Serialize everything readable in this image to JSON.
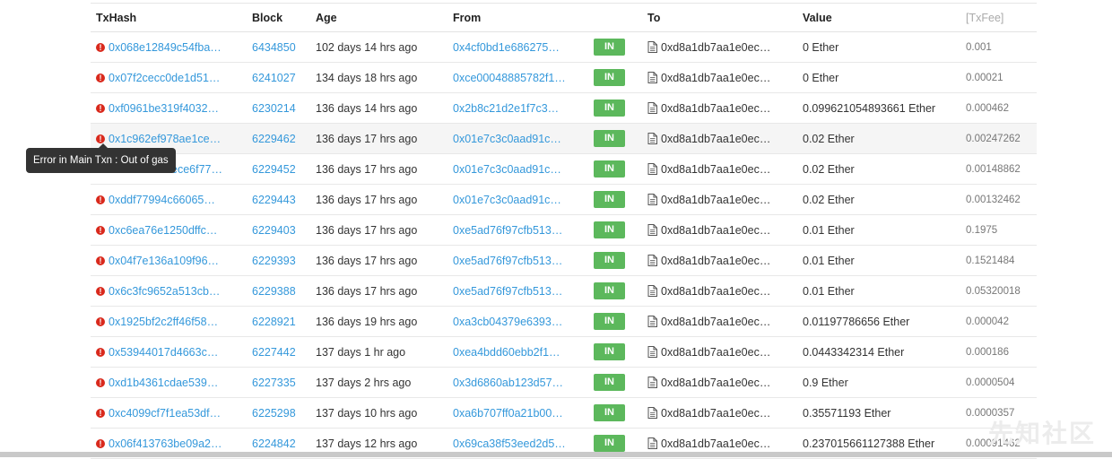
{
  "columns": {
    "txhash": "TxHash",
    "block": "Block",
    "age": "Age",
    "from": "From",
    "to": "To",
    "value": "Value",
    "txfee": "[TxFee]"
  },
  "tooltip": "Error in Main Txn : Out of gas",
  "watermark": "先知社区",
  "rows": [
    {
      "hash": "0x068e12849c54fba…",
      "block": "6434850",
      "age": "102 days 14 hrs ago",
      "from": "0x4cf0bd1e686275…",
      "dir": "IN",
      "to": "0xd8a1db7aa1e0ec…",
      "value": "0 Ether",
      "fee": "0.001"
    },
    {
      "hash": "0x07f2cecc0de1d51…",
      "block": "6241027",
      "age": "134 days 18 hrs ago",
      "from": "0xce00048885782f1…",
      "dir": "IN",
      "to": "0xd8a1db7aa1e0ec…",
      "value": "0 Ether",
      "fee": "0.00021"
    },
    {
      "hash": "0xf0961be319f4032…",
      "block": "6230214",
      "age": "136 days 14 hrs ago",
      "from": "0x2b8c21d2e1f7c3…",
      "dir": "IN",
      "to": "0xd8a1db7aa1e0ec…",
      "value": "0.099621054893661 Ether",
      "fee": "0.000462"
    },
    {
      "hash": "0x1c962ef978ae1ce…",
      "block": "6229462",
      "age": "136 days 17 hrs ago",
      "from": "0x01e7c3c0aad91c…",
      "dir": "IN",
      "to": "0xd8a1db7aa1e0ec…",
      "value": "0.02 Ether",
      "fee": "0.00247262"
    },
    {
      "hash": "ece6f77…",
      "block": "6229452",
      "age": "136 days 17 hrs ago",
      "from": "0x01e7c3c0aad91c…",
      "dir": "IN",
      "to": "0xd8a1db7aa1e0ec…",
      "value": "0.02 Ether",
      "fee": "0.00148862"
    },
    {
      "hash": "0xddf77994c66065…",
      "block": "6229443",
      "age": "136 days 17 hrs ago",
      "from": "0x01e7c3c0aad91c…",
      "dir": "IN",
      "to": "0xd8a1db7aa1e0ec…",
      "value": "0.02 Ether",
      "fee": "0.00132462"
    },
    {
      "hash": "0xc6ea76e1250dffc…",
      "block": "6229403",
      "age": "136 days 17 hrs ago",
      "from": "0xe5ad76f97cfb513…",
      "dir": "IN",
      "to": "0xd8a1db7aa1e0ec…",
      "value": "0.01 Ether",
      "fee": "0.1975"
    },
    {
      "hash": "0x04f7e136a109f96…",
      "block": "6229393",
      "age": "136 days 17 hrs ago",
      "from": "0xe5ad76f97cfb513…",
      "dir": "IN",
      "to": "0xd8a1db7aa1e0ec…",
      "value": "0.01 Ether",
      "fee": "0.1521484"
    },
    {
      "hash": "0x6c3fc9652a513cb…",
      "block": "6229388",
      "age": "136 days 17 hrs ago",
      "from": "0xe5ad76f97cfb513…",
      "dir": "IN",
      "to": "0xd8a1db7aa1e0ec…",
      "value": "0.01 Ether",
      "fee": "0.05320018"
    },
    {
      "hash": "0x1925bf2c2ff46f58…",
      "block": "6228921",
      "age": "136 days 19 hrs ago",
      "from": "0xa3cb04379e6393…",
      "dir": "IN",
      "to": "0xd8a1db7aa1e0ec…",
      "value": "0.01197786656 Ether",
      "fee": "0.000042"
    },
    {
      "hash": "0x53944017d4663c…",
      "block": "6227442",
      "age": "137 days 1 hr ago",
      "from": "0xea4bdd60ebb2f1…",
      "dir": "IN",
      "to": "0xd8a1db7aa1e0ec…",
      "value": "0.0443342314 Ether",
      "fee": "0.000186"
    },
    {
      "hash": "0xd1b4361cdae539…",
      "block": "6227335",
      "age": "137 days 2 hrs ago",
      "from": "0x3d6860ab123d57…",
      "dir": "IN",
      "to": "0xd8a1db7aa1e0ec…",
      "value": "0.9 Ether",
      "fee": "0.0000504"
    },
    {
      "hash": "0xc4099cf7f1ea53df…",
      "block": "6225298",
      "age": "137 days 10 hrs ago",
      "from": "0xa6b707ff0a21b00…",
      "dir": "IN",
      "to": "0xd8a1db7aa1e0ec…",
      "value": "0.35571193 Ether",
      "fee": "0.0000357"
    },
    {
      "hash": "0x06f413763be09a2…",
      "block": "6224842",
      "age": "137 days 12 hrs ago",
      "from": "0x69ca38f53eed2d5…",
      "dir": "IN",
      "to": "0xd8a1db7aa1e0ec…",
      "value": "0.237015661127388 Ether",
      "fee": "0.00091462"
    }
  ],
  "error_icon": "exclamation-circle-icon",
  "contract_icon": "document-icon",
  "colors": {
    "link": "#3498db",
    "in_badge": "#5cb85c",
    "error": "#d9291c"
  }
}
